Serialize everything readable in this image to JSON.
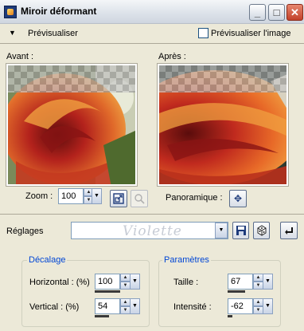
{
  "window": {
    "title": "Miroir déformant"
  },
  "preview_toggle": {
    "label": "Prévisualiser",
    "checkbox_label": "Prévisualiser l'image"
  },
  "panes": {
    "before_label": "Avant :",
    "after_label": "Après :"
  },
  "zoom": {
    "label": "Zoom :",
    "value": "100"
  },
  "pan": {
    "label": "Panoramique :"
  },
  "presets": {
    "label": "Réglages",
    "value": "Violette"
  },
  "offset_group": {
    "title": "Décalage",
    "horizontal_label": "Horizontal : (%)",
    "horizontal_value": "100",
    "vertical_label": "Vertical : (%)",
    "vertical_value": "54"
  },
  "params_group": {
    "title": "Paramètres",
    "size_label": "Taille :",
    "size_value": "67",
    "intensity_label": "Intensité :",
    "intensity_value": "-62"
  },
  "colors": {
    "accent": "#0046d5",
    "window_bg": "#ece9d8"
  }
}
